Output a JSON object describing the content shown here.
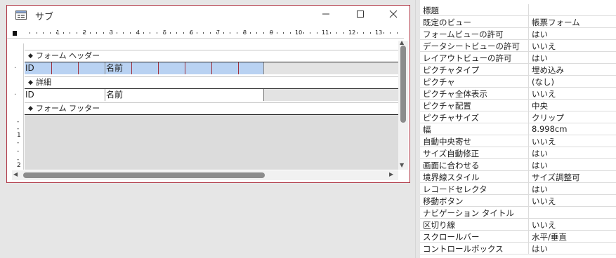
{
  "window": {
    "title": "サブ"
  },
  "ruler": {
    "numbers": [
      "1",
      "2",
      "3",
      "4",
      "5",
      "6",
      "7",
      "8",
      "9",
      "10",
      "11",
      "12",
      "13",
      "1"
    ]
  },
  "vertical_ruler": {
    "numbers": [
      "1",
      "2"
    ]
  },
  "sections": {
    "header": "フォーム ヘッダー",
    "detail": "詳細",
    "footer": "フォーム フッター"
  },
  "header_controls": {
    "id_label": "ID",
    "name_label": "名前"
  },
  "detail_controls": {
    "id_field": "ID",
    "name_field": "名前"
  },
  "properties": [
    {
      "name": "標題",
      "value": ""
    },
    {
      "name": "既定のビュー",
      "value": "帳票フォーム"
    },
    {
      "name": "フォームビューの許可",
      "value": "はい"
    },
    {
      "name": "データシートビューの許可",
      "value": "いいえ"
    },
    {
      "name": "レイアウトビューの許可",
      "value": "はい"
    },
    {
      "name": "ピクチャタイプ",
      "value": "埋め込み"
    },
    {
      "name": "ピクチャ",
      "value": "(なし)"
    },
    {
      "name": "ピクチャ全体表示",
      "value": "いいえ"
    },
    {
      "name": "ピクチャ配置",
      "value": "中央"
    },
    {
      "name": "ピクチャサイズ",
      "value": "クリップ"
    },
    {
      "name": "幅",
      "value": "8.998cm"
    },
    {
      "name": "自動中央寄せ",
      "value": "いいえ"
    },
    {
      "name": "サイズ自動修正",
      "value": "はい"
    },
    {
      "name": "画面に合わせる",
      "value": "はい"
    },
    {
      "name": "境界線スタイル",
      "value": "サイズ調整可"
    },
    {
      "name": "レコードセレクタ",
      "value": "はい"
    },
    {
      "name": "移動ボタン",
      "value": "いいえ"
    },
    {
      "name": "ナビゲーション タイトル",
      "value": ""
    },
    {
      "name": "区切り線",
      "value": "いいえ"
    },
    {
      "name": "スクロールバー",
      "value": "水平/垂直"
    },
    {
      "name": "コントロールボックス",
      "value": "はい"
    }
  ]
}
